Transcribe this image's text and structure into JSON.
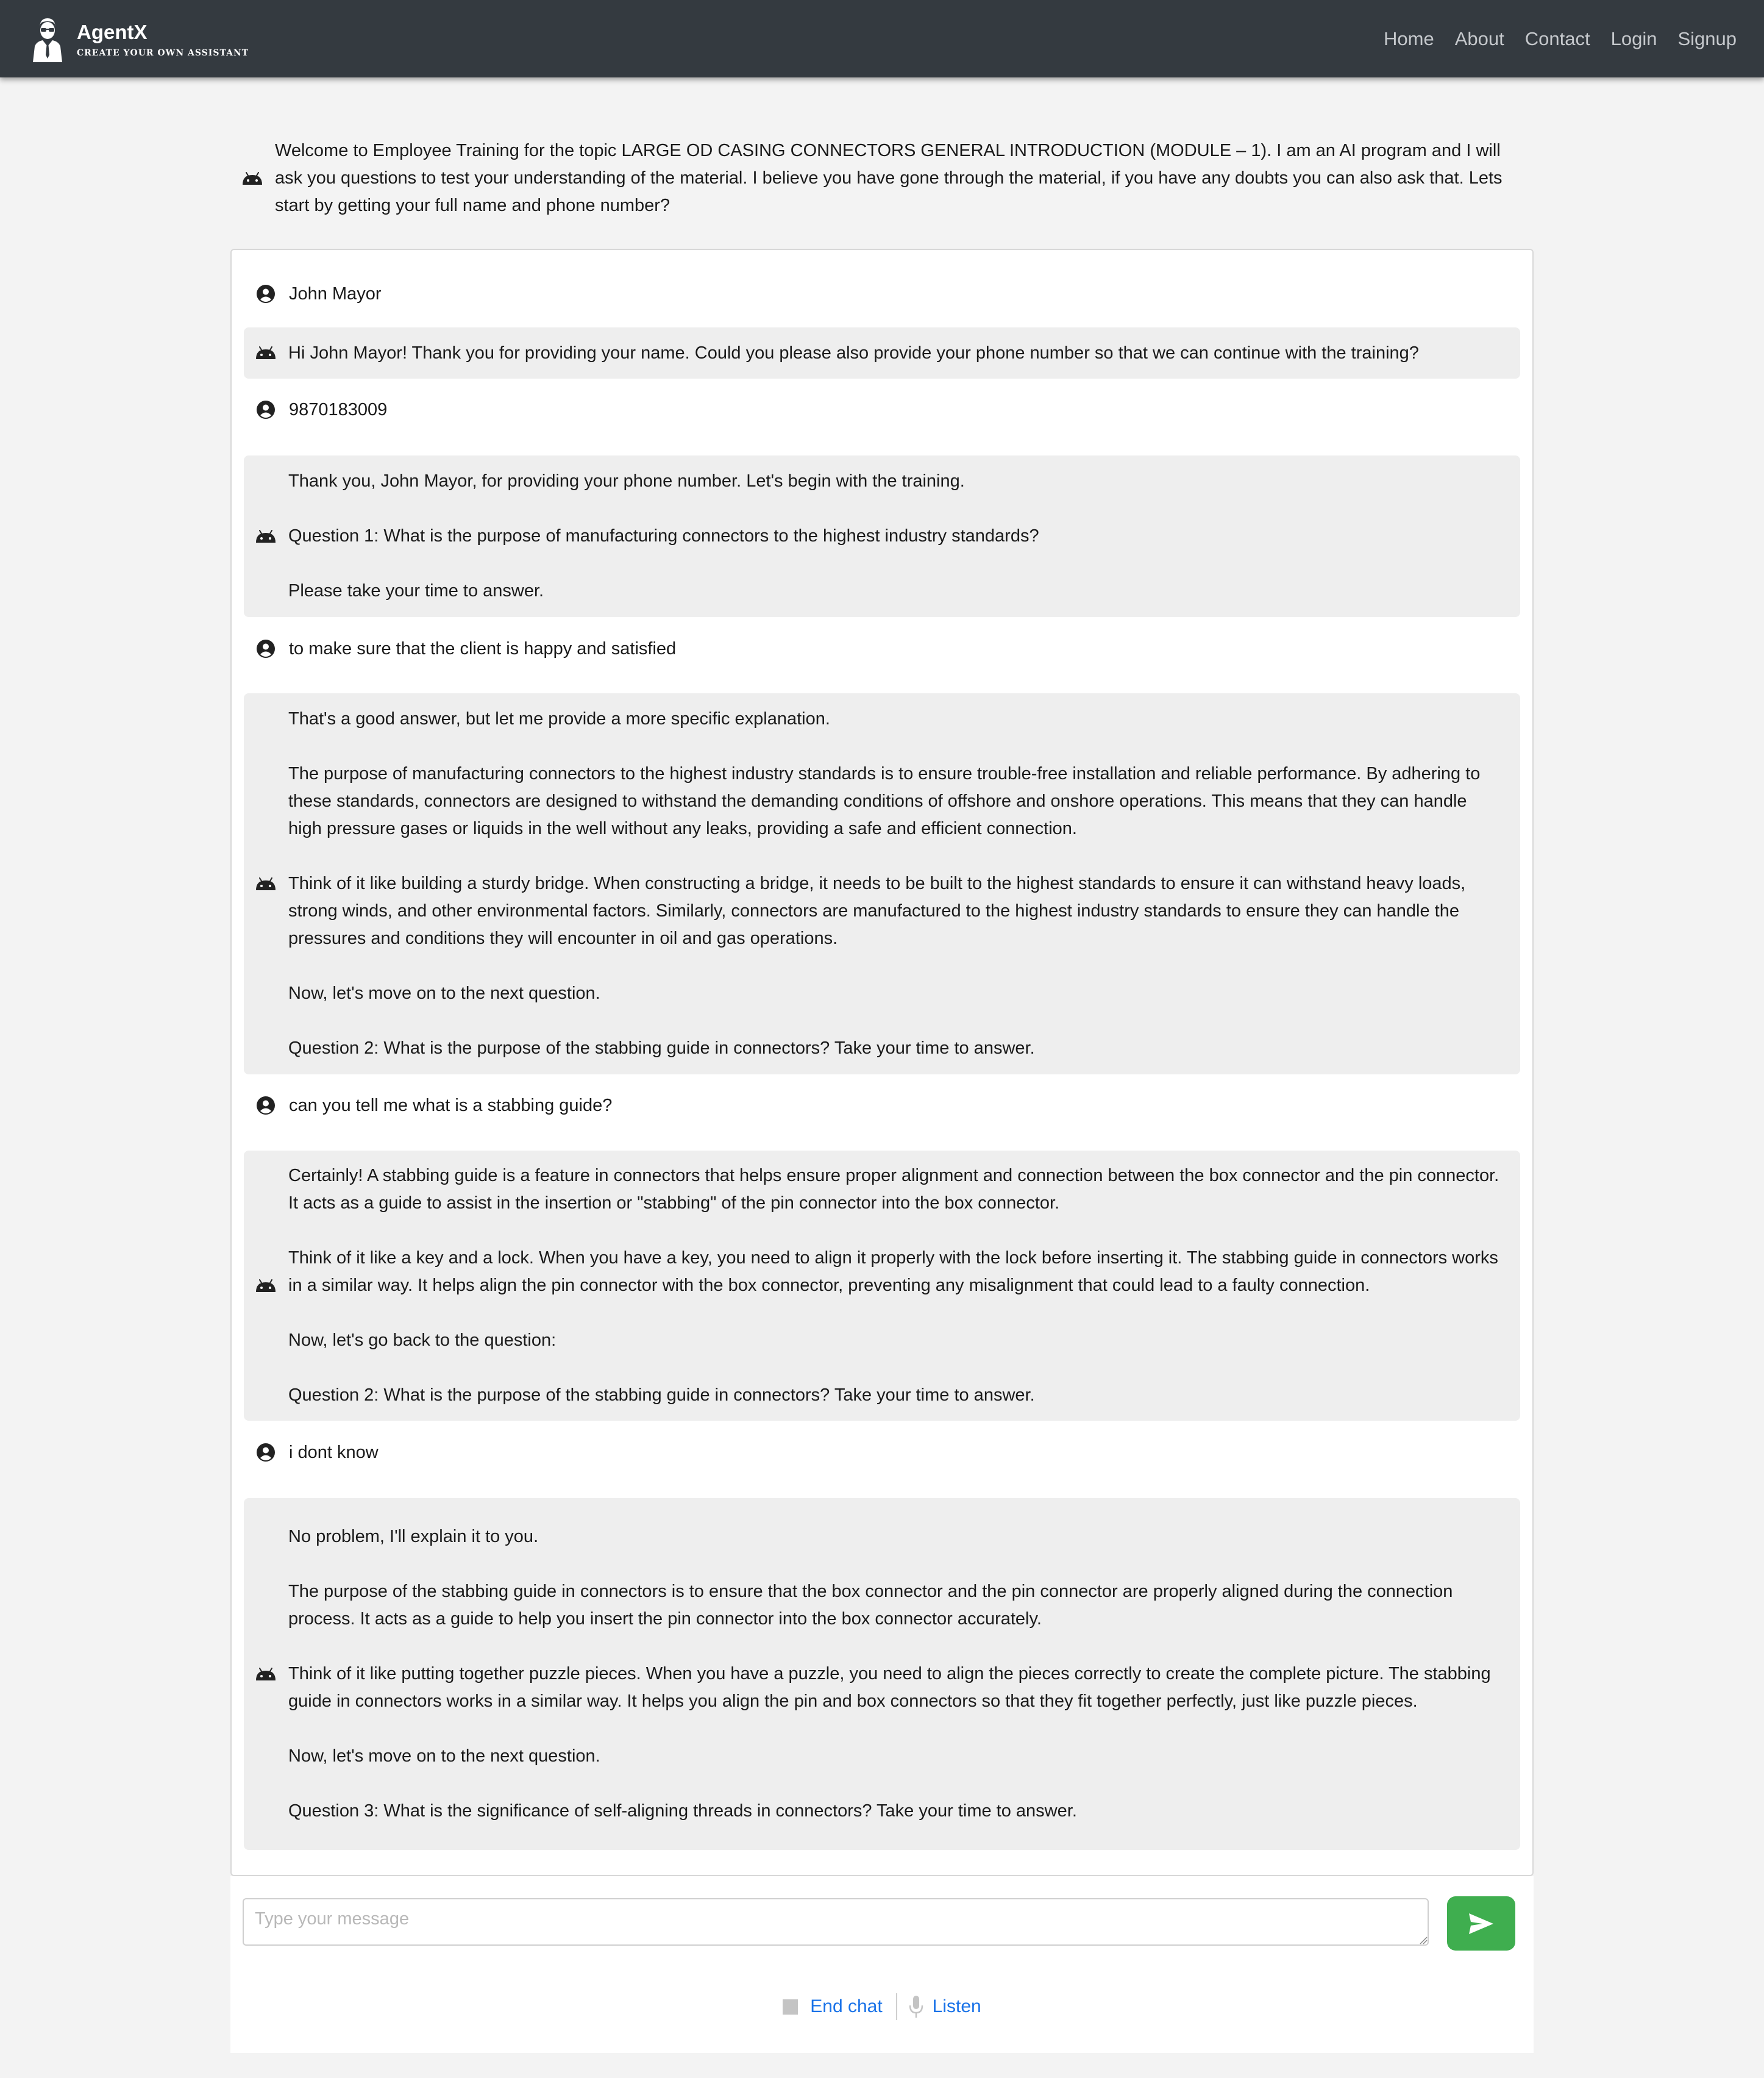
{
  "navbar": {
    "brand_name": "AgentX",
    "brand_tagline": "CREATE YOUR OWN ASSISTANT",
    "links": [
      "Home",
      "About",
      "Contact",
      "Login",
      "Signup"
    ]
  },
  "welcome_message": "Welcome to Employee Training for the topic LARGE OD CASING CONNECTORS GENERAL INTRODUCTION (MODULE – 1). I am an AI program and I will ask you questions to test your understanding of the material. I believe you have gone through the material, if you have any doubts you can also ask that. Lets start by getting your full name and phone number?",
  "messages": [
    {
      "role": "user",
      "icon": "user-circle-icon",
      "paragraphs": [
        "John Mayor"
      ]
    },
    {
      "role": "bot",
      "icon": "android-icon",
      "paragraphs": [
        "Hi John Mayor! Thank you for providing your name. Could you please also provide your phone number so that we can continue with the training?"
      ]
    },
    {
      "role": "user",
      "icon": "user-circle-icon",
      "paragraphs": [
        "9870183009"
      ]
    },
    {
      "role": "bot",
      "icon": "android-icon",
      "paragraphs": [
        "Thank you, John Mayor, for providing your phone number. Let's begin with the training.",
        "Question 1: What is the purpose of manufacturing connectors to the highest industry standards?",
        "Please take your time to answer."
      ]
    },
    {
      "role": "user",
      "icon": "user-circle-icon",
      "paragraphs": [
        "to make sure that the client is happy and satisfied"
      ]
    },
    {
      "role": "bot",
      "icon": "android-icon",
      "paragraphs": [
        "That's a good answer, but let me provide a more specific explanation.",
        "The purpose of manufacturing connectors to the highest industry standards is to ensure trouble-free installation and reliable performance. By adhering to these standards, connectors are designed to withstand the demanding conditions of offshore and onshore operations. This means that they can handle high pressure gases or liquids in the well without any leaks, providing a safe and efficient connection.",
        "Think of it like building a sturdy bridge. When constructing a bridge, it needs to be built to the highest standards to ensure it can withstand heavy loads, strong winds, and other environmental factors. Similarly, connectors are manufactured to the highest industry standards to ensure they can handle the pressures and conditions they will encounter in oil and gas operations.",
        "Now, let's move on to the next question.",
        "Question 2: What is the purpose of the stabbing guide in connectors? Take your time to answer."
      ]
    },
    {
      "role": "user",
      "icon": "user-circle-icon",
      "paragraphs": [
        "can you tell me what is a stabbing guide?"
      ]
    },
    {
      "role": "bot",
      "icon": "android-icon",
      "paragraphs": [
        "Certainly! A stabbing guide is a feature in connectors that helps ensure proper alignment and connection between the box connector and the pin connector. It acts as a guide to assist in the insertion or \"stabbing\" of the pin connector into the box connector.",
        "Think of it like a key and a lock. When you have a key, you need to align it properly with the lock before inserting it. The stabbing guide in connectors works in a similar way. It helps align the pin connector with the box connector, preventing any misalignment that could lead to a faulty connection.",
        "Now, let's go back to the question:",
        "Question 2: What is the purpose of the stabbing guide in connectors? Take your time to answer."
      ]
    },
    {
      "role": "user",
      "icon": "user-circle-icon",
      "paragraphs": [
        "i dont know"
      ]
    },
    {
      "role": "bot",
      "icon": "android-icon",
      "paragraphs": [
        "No problem, I'll explain it to you.",
        "The purpose of the stabbing guide in connectors is to ensure that the box connector and the pin connector are properly aligned during the connection process. It acts as a guide to help you insert the pin connector into the box connector accurately.",
        "Think of it like putting together puzzle pieces. When you have a puzzle, you need to align the pieces correctly to create the complete picture. The stabbing guide in connectors works in a similar way. It helps you align the pin and box connectors so that they fit together perfectly, just like puzzle pieces.",
        "Now, let's move on to the next question.",
        "Question 3: What is the significance of self-aligning threads in connectors? Take your time to answer."
      ]
    }
  ],
  "composer": {
    "placeholder": "Type your message",
    "value": "",
    "send_icon": "send-icon",
    "send_color": "#3fae4f"
  },
  "controls": {
    "end_chat_label": "End chat",
    "listen_label": "Listen",
    "link_color": "#1a73e8"
  },
  "colors": {
    "navbar_bg": "#343a40",
    "page_bg": "#f3f3f3",
    "bot_bubble_bg": "#eeeeee"
  }
}
